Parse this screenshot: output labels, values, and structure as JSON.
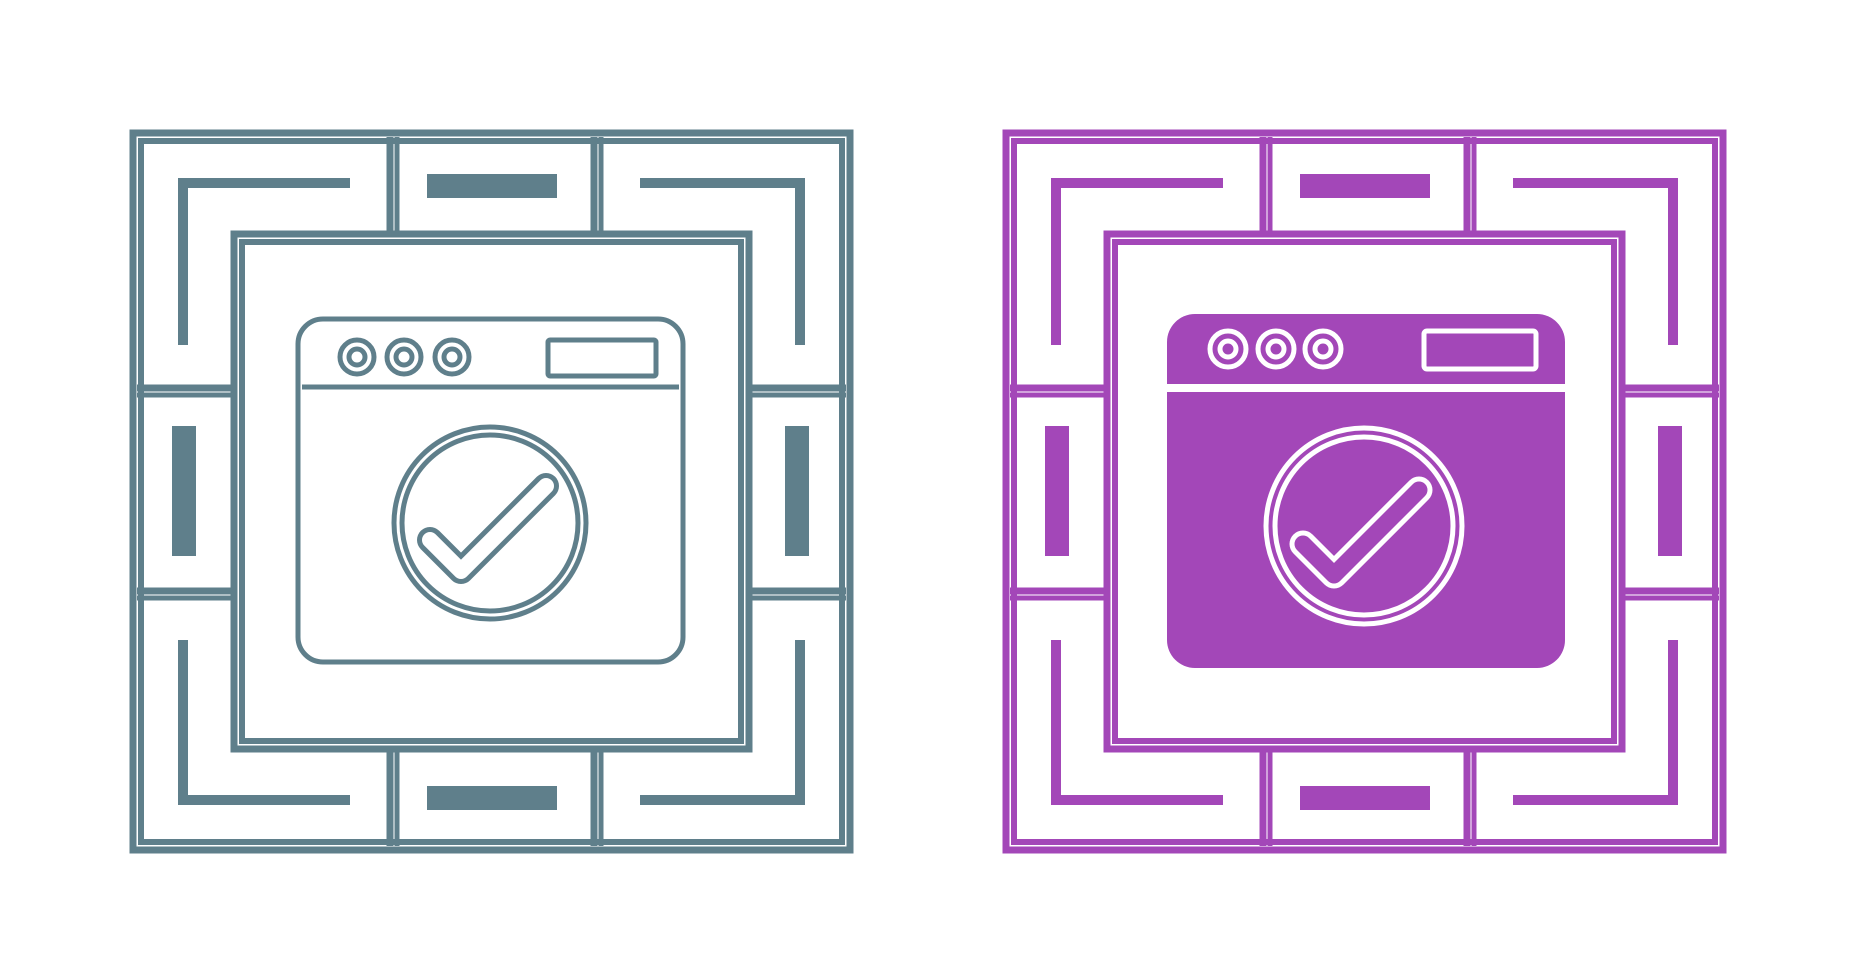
{
  "icons": [
    {
      "name": "browser-check-outline",
      "style": "outline",
      "color": "#5f7f8b",
      "glyph": "browser-window-with-check-icon"
    },
    {
      "name": "browser-check-glyph",
      "style": "filled",
      "color": "#a347b8",
      "glyph": "browser-window-with-check-icon"
    }
  ],
  "background": "#ffffff"
}
